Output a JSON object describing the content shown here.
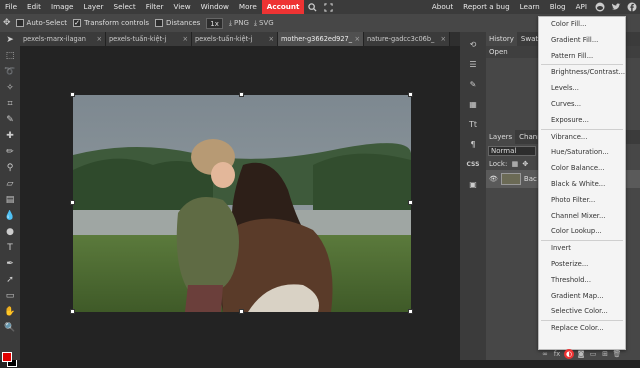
{
  "menubar": {
    "items": [
      "File",
      "Edit",
      "Image",
      "Layer",
      "Select",
      "Filter",
      "View",
      "Window",
      "More",
      "Account"
    ],
    "right_links": [
      "About",
      "Report a bug",
      "Learn",
      "Blog",
      "API"
    ],
    "icons": [
      "search-icon",
      "fullscreen-icon",
      "reddit-icon",
      "twitter-icon",
      "facebook-icon"
    ]
  },
  "options": {
    "auto_select_label": "Auto-Select",
    "transform_controls_label": "Transform controls",
    "distances_label": "Distances",
    "zoom_value": "1x",
    "png_label": "PNG",
    "svg_label": "SVG"
  },
  "tabs": [
    {
      "label": "pexels-marx-ilagan"
    },
    {
      "label": "pexels-tuấn-kiệt-j"
    },
    {
      "label": "pexels-tuấn-kiệt-j"
    },
    {
      "label": "mother-g3662ed927_"
    },
    {
      "label": "nature-gadcc3c06b_"
    }
  ],
  "panel": {
    "history_tab": "History",
    "swatches_tab": "Swat",
    "history_item": "Open",
    "layers_tab": "Layers",
    "channels_tab": "Chann",
    "blend_mode": "Normal",
    "lock_label": "Lock:",
    "layer_name": "Bac"
  },
  "adjust_menu": {
    "groups": [
      [
        "Color Fill...",
        "Gradient Fill...",
        "Pattern Fill..."
      ],
      [
        "Brightness/Contrast...",
        "Levels...",
        "Curves...",
        "Exposure..."
      ],
      [
        "Vibrance...",
        "Hue/Saturation...",
        "Color Balance...",
        "Black & White...",
        "Photo Filter...",
        "Channel Mixer...",
        "Color Lookup..."
      ],
      [
        "Invert",
        "Posterize...",
        "Threshold...",
        "Gradient Map...",
        "Selective Color..."
      ],
      [
        "Replace Color..."
      ]
    ]
  },
  "colors": {
    "accent": "#e33333",
    "foreground_swatch": "#e00000",
    "background_swatch": "#000000"
  }
}
